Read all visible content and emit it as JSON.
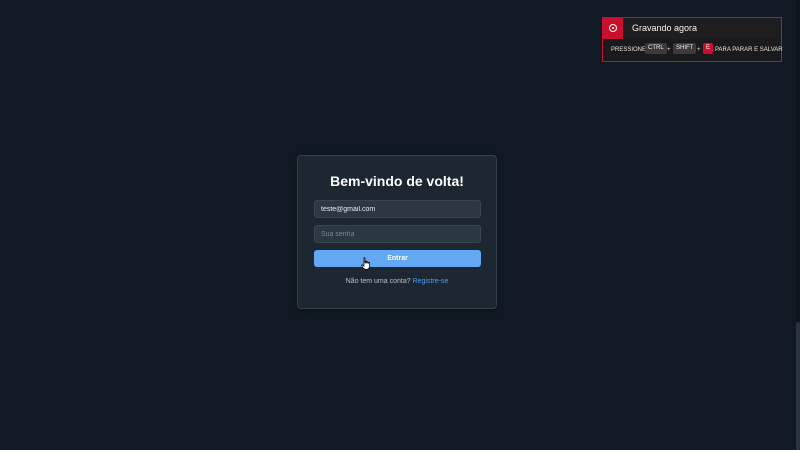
{
  "recording": {
    "title": "Gravando agora",
    "instruction_prefix": "PRESSIONE",
    "key_ctrl": "CTRL",
    "key_shift": "SHIFT",
    "key_e": "E",
    "plus": "+",
    "instruction_suffix": "PARA PARAR E SALVAR",
    "icon": "record-icon",
    "accent_color": "#c8102e"
  },
  "login": {
    "title": "Bem-vindo de volta!",
    "email_value": "teste@gmail.com",
    "password_placeholder": "Sua senha",
    "submit_label": "Entrar",
    "signup_prompt": "Não tem uma conta?",
    "signup_link": "Registre-se",
    "accent_color": "#63a8f2",
    "link_color": "#4d9cf0"
  },
  "cursor": {
    "icon": "hand-pointer-icon"
  }
}
